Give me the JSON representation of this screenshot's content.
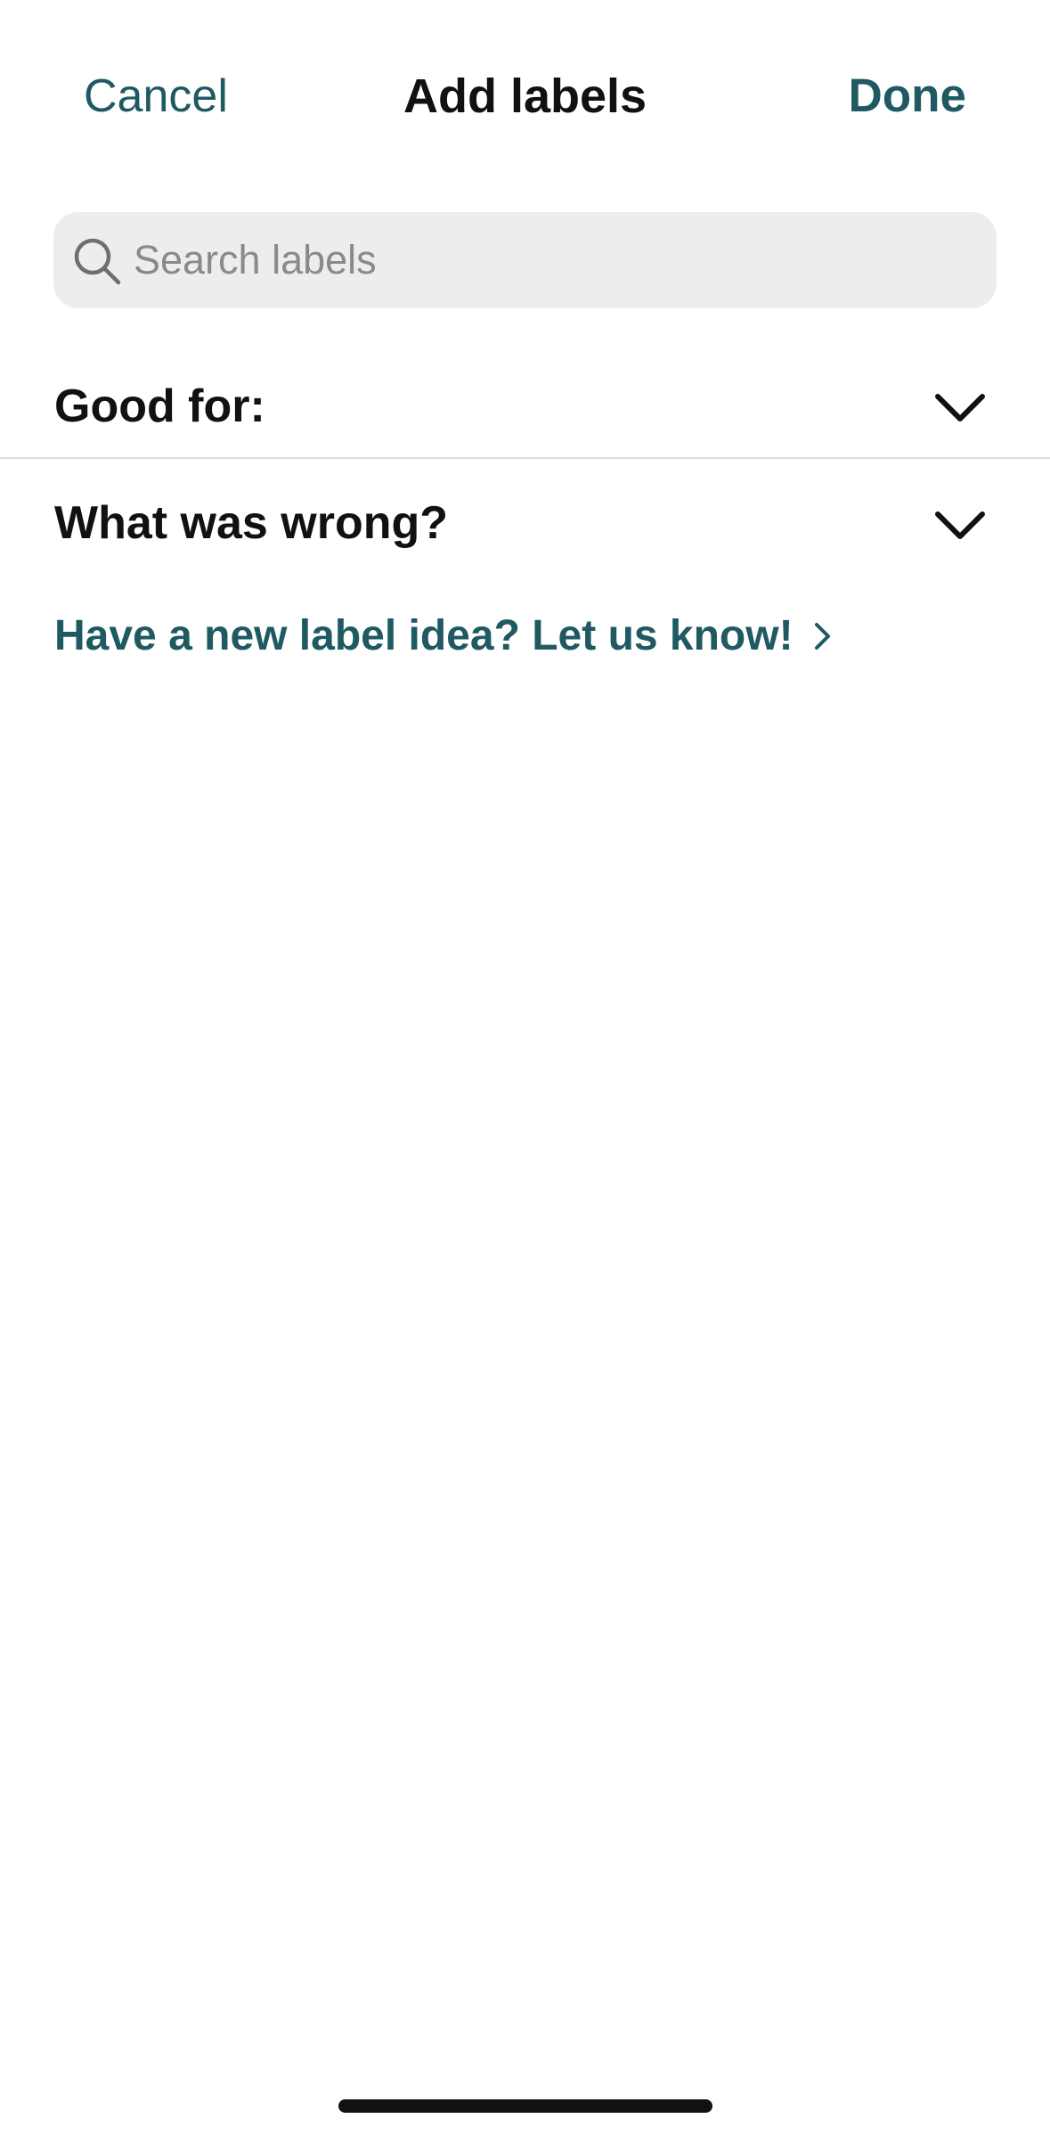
{
  "nav": {
    "cancel_label": "Cancel",
    "title": "Add labels",
    "done_label": "Done"
  },
  "search": {
    "placeholder": "Search labels",
    "value": "",
    "icon": "search-icon"
  },
  "sections": [
    {
      "label": "Good for:",
      "icon": "chevron-down-icon",
      "expanded": false
    },
    {
      "label": "What was wrong?",
      "icon": "chevron-down-icon",
      "expanded": false
    }
  ],
  "feedback": {
    "link_label": "Have a new label idea? Let us know!",
    "icon": "chevron-right-icon"
  },
  "colors": {
    "accent": "#1f5a63",
    "text": "#111111",
    "search_bg": "#ededed",
    "placeholder": "#8a8a8a",
    "divider": "#dcdcdc"
  }
}
